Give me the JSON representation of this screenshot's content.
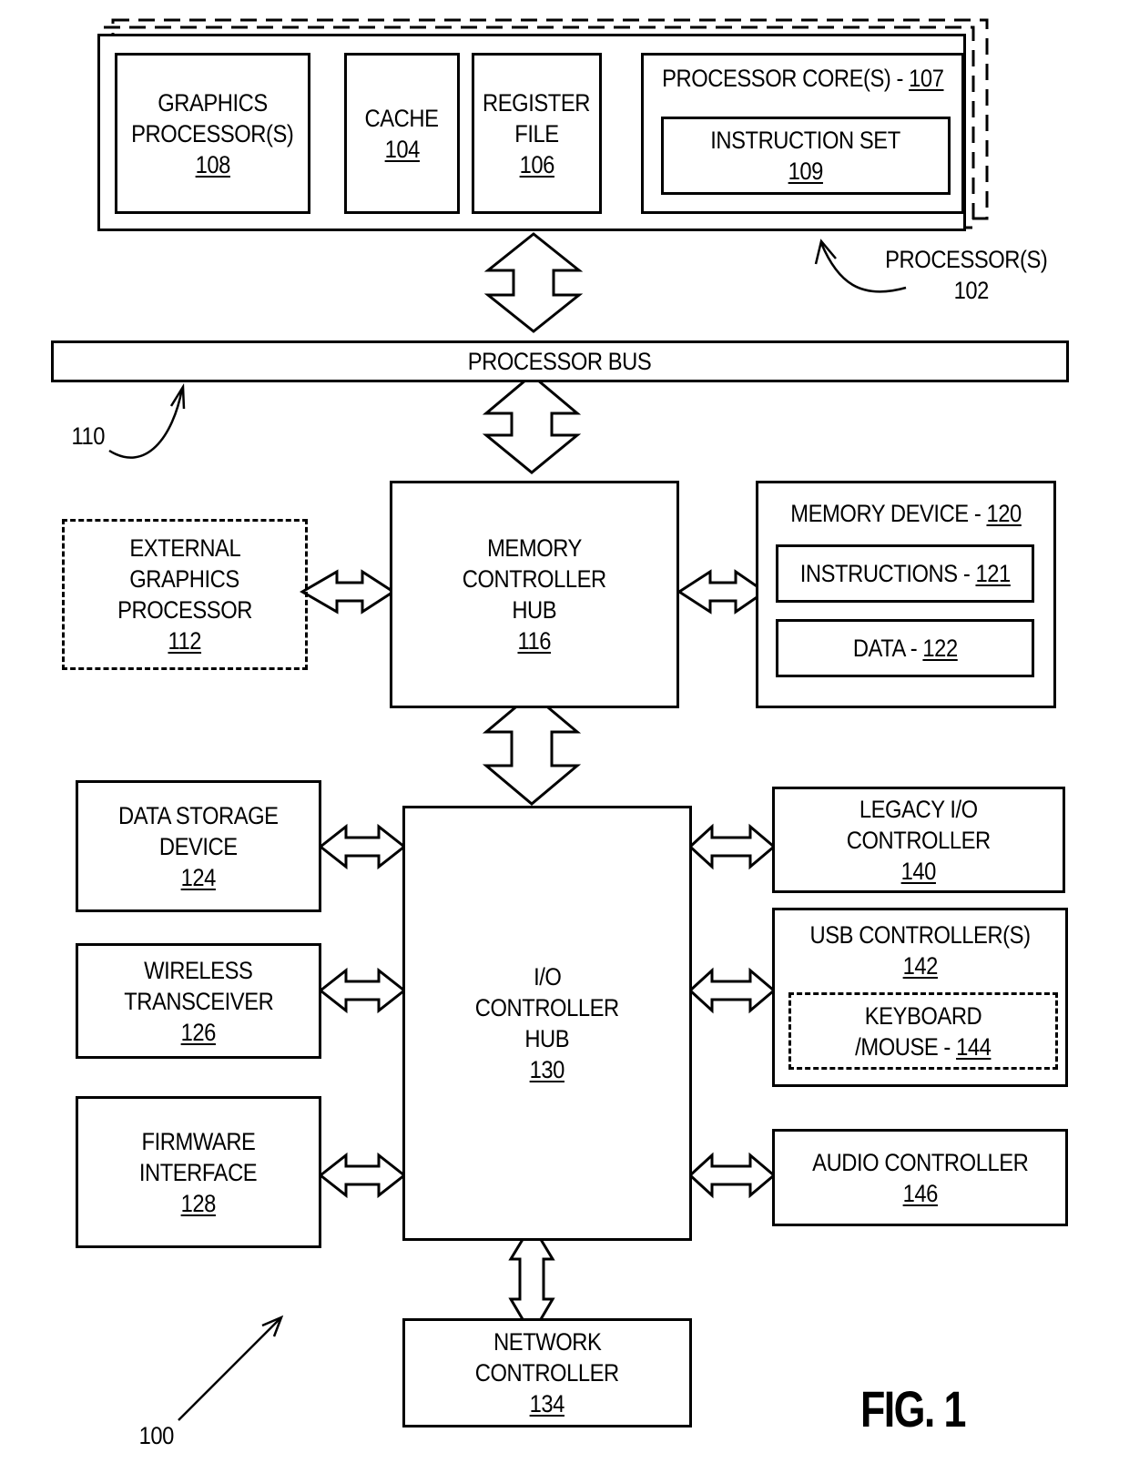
{
  "figure": {
    "title": "FIG. 1",
    "system_ref": "100",
    "processor_ref_label": "PROCESSOR(S)",
    "processor_ref": "102",
    "bus_ref": "110"
  },
  "processor": {
    "graphics": {
      "lines": [
        "GRAPHICS",
        "PROCESSOR(S)"
      ],
      "num": "108"
    },
    "cache": {
      "lines": [
        "CACHE"
      ],
      "num": "104"
    },
    "register_file": {
      "lines": [
        "REGISTER",
        "FILE"
      ],
      "num": "106"
    },
    "core": {
      "label": "PROCESSOR CORE(S) - ",
      "num": "107"
    },
    "instruction_set": {
      "label": "INSTRUCTION SET",
      "num": "109"
    }
  },
  "processor_bus": {
    "label": "PROCESSOR BUS"
  },
  "external_graphics": {
    "lines": [
      "EXTERNAL",
      "GRAPHICS",
      "PROCESSOR"
    ],
    "num": "112"
  },
  "memory_controller_hub": {
    "lines": [
      "MEMORY",
      "CONTROLLER",
      "HUB"
    ],
    "num": "116"
  },
  "memory_device": {
    "label": "MEMORY DEVICE - ",
    "num": "120",
    "instructions": {
      "label": "INSTRUCTIONS - ",
      "num": "121"
    },
    "data": {
      "label": "DATA - ",
      "num": "122"
    }
  },
  "io_controller_hub": {
    "lines": [
      "I/O",
      "CONTROLLER",
      "HUB"
    ],
    "num": "130"
  },
  "data_storage": {
    "lines": [
      "DATA STORAGE",
      "DEVICE"
    ],
    "num": "124"
  },
  "wireless": {
    "lines": [
      "WIRELESS",
      "TRANSCEIVER"
    ],
    "num": "126"
  },
  "firmware": {
    "lines": [
      "FIRMWARE",
      "INTERFACE"
    ],
    "num": "128"
  },
  "legacy_io": {
    "lines": [
      "LEGACY I/O",
      "CONTROLLER"
    ],
    "num": "140"
  },
  "usb": {
    "lines": [
      "USB CONTROLLER(S)"
    ],
    "num": "142",
    "keyboard": {
      "line1": "KEYBOARD",
      "line2": "/MOUSE - ",
      "num": "144"
    }
  },
  "audio": {
    "lines": [
      "AUDIO CONTROLLER"
    ],
    "num": "146"
  },
  "network": {
    "lines": [
      "NETWORK",
      "CONTROLLER"
    ],
    "num": "134"
  }
}
